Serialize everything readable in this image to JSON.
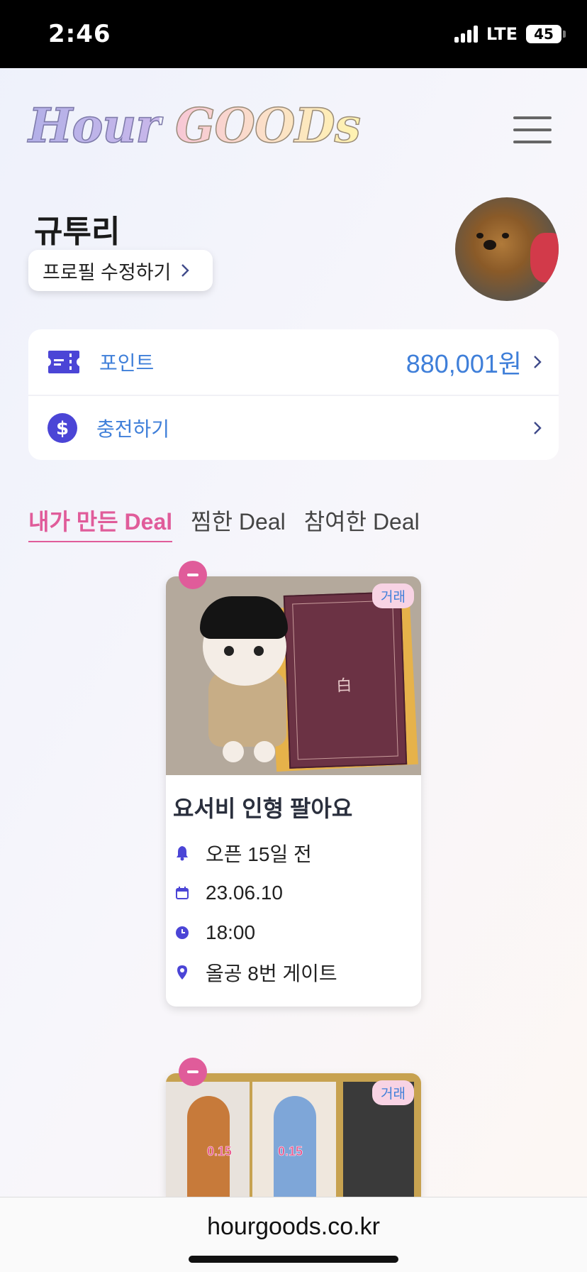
{
  "status_bar": {
    "time": "2:46",
    "network": "LTE",
    "battery": "45"
  },
  "header": {
    "logo_part1": "Hour",
    "logo_part2": "GOODs"
  },
  "profile": {
    "username": "규투리",
    "edit_label": "프로필 수정하기"
  },
  "wallet": {
    "point_label": "포인트",
    "point_value": "880,001원",
    "charge_label": "충전하기"
  },
  "tabs": [
    {
      "label": "내가 만든 Deal",
      "active": true
    },
    {
      "label": "찜한 Deal",
      "active": false
    },
    {
      "label": "참여한 Deal",
      "active": false
    }
  ],
  "deals": [
    {
      "badge": "거래",
      "title": "요서비 인형 팔아요",
      "open": "오픈 15일 전",
      "date": "23.06.10",
      "time": "18:00",
      "location": "올공 8번 게이트"
    },
    {
      "badge": "거래",
      "photo_label_1": "0.15",
      "photo_label_2": "0.15"
    }
  ],
  "browser": {
    "url": "hourgoods.co.kr"
  },
  "colors": {
    "accent_pink": "#e05c9a",
    "accent_blue": "#3f7fd9",
    "icon_purple": "#4b45d6"
  }
}
